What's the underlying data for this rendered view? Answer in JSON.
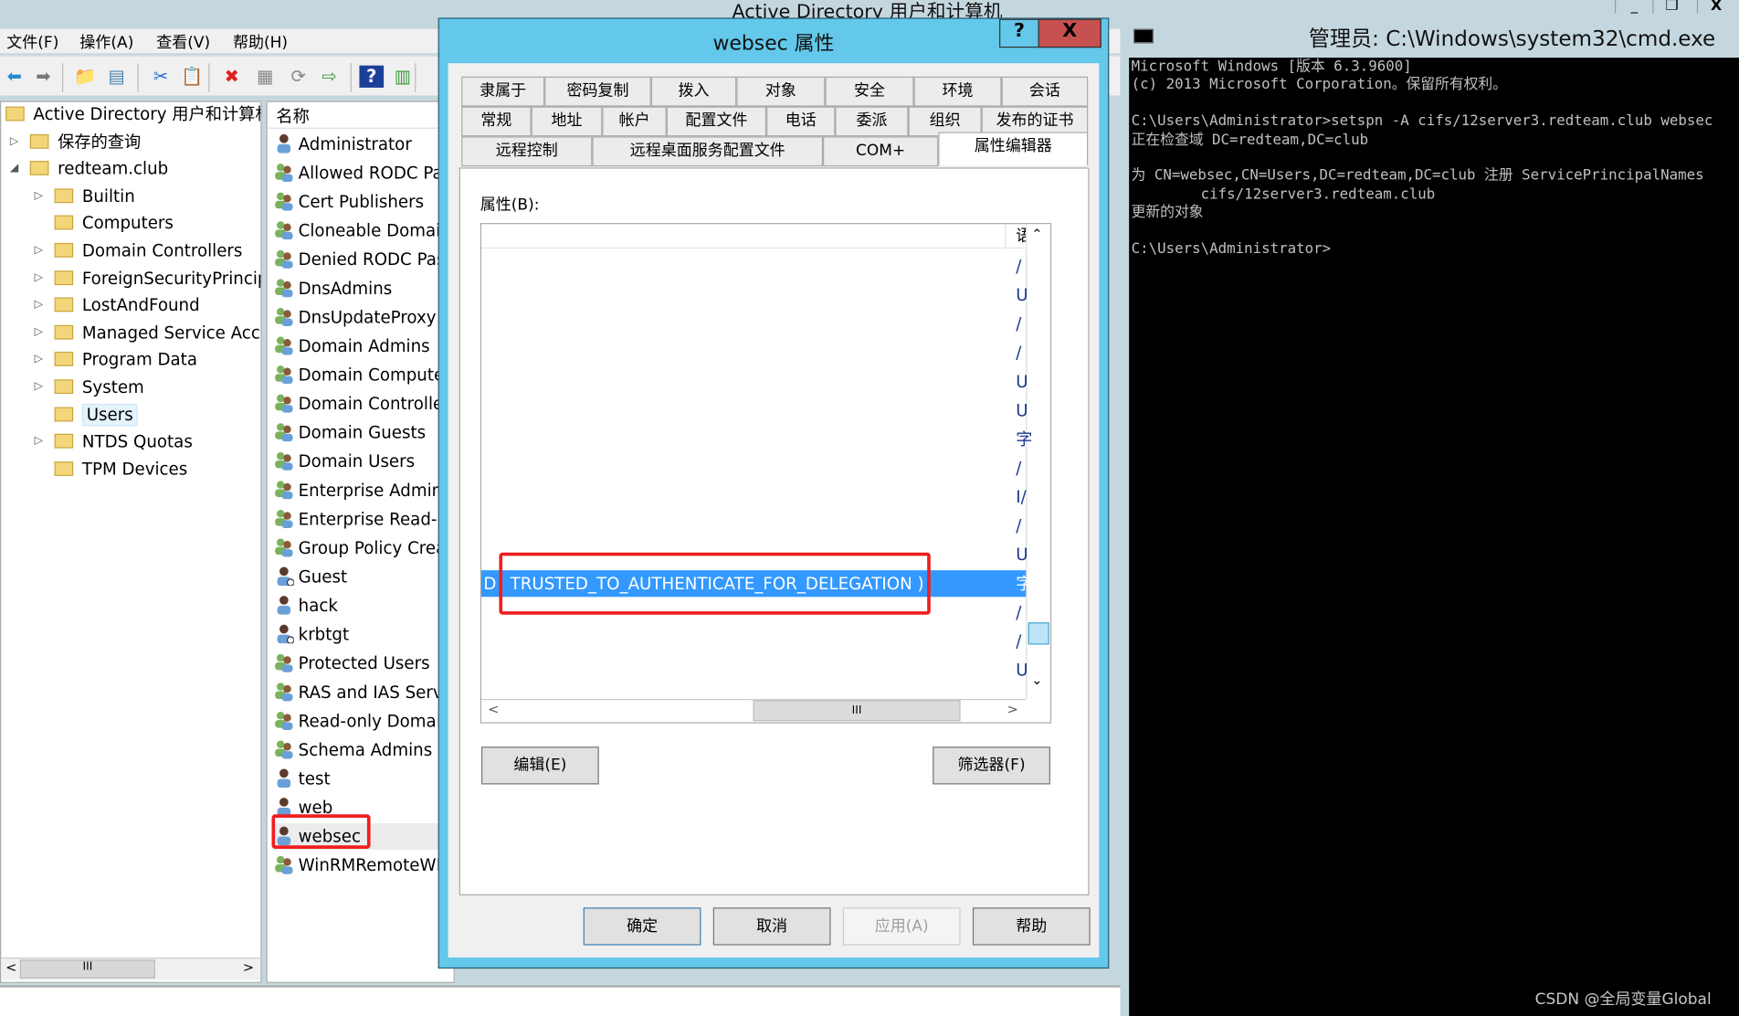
{
  "app": {
    "title": "Active Directory 用户和计算机"
  },
  "menu": [
    "文件(F)",
    "操作(A)",
    "查看(V)",
    "帮助(H)"
  ],
  "toolbar_icons": [
    "back-icon",
    "forward-icon",
    "up-folder-icon",
    "show-tree-icon",
    "cut-icon",
    "paste-icon",
    "delete-icon",
    "properties-icon",
    "refresh-icon",
    "export-icon",
    "help-icon",
    "console-icon"
  ],
  "tree": {
    "root": "Active Directory 用户和计算机",
    "items": [
      {
        "label": "保存的查询",
        "level": 1,
        "expander": "▷"
      },
      {
        "label": "redteam.club",
        "level": 1,
        "expander": "◢"
      },
      {
        "label": "Builtin",
        "level": 2,
        "expander": "▷"
      },
      {
        "label": "Computers",
        "level": 2,
        "expander": ""
      },
      {
        "label": "Domain Controllers",
        "level": 2,
        "expander": "▷"
      },
      {
        "label": "ForeignSecurityPrincipals",
        "level": 2,
        "expander": "▷"
      },
      {
        "label": "LostAndFound",
        "level": 2,
        "expander": "▷"
      },
      {
        "label": "Managed Service Accounts",
        "level": 2,
        "expander": "▷"
      },
      {
        "label": "Program Data",
        "level": 2,
        "expander": "▷"
      },
      {
        "label": "System",
        "level": 2,
        "expander": "▷"
      },
      {
        "label": "Users",
        "level": 2,
        "expander": "",
        "selected": true
      },
      {
        "label": "NTDS Quotas",
        "level": 2,
        "expander": "▷"
      },
      {
        "label": "TPM Devices",
        "level": 2,
        "expander": ""
      }
    ]
  },
  "list": {
    "header": "名称",
    "items": [
      {
        "name": "Administrator",
        "type": "user"
      },
      {
        "name": "Allowed RODC Password Replication Group",
        "type": "group"
      },
      {
        "name": "Cert Publishers",
        "type": "group"
      },
      {
        "name": "Cloneable Domain Controllers",
        "type": "group"
      },
      {
        "name": "Denied RODC Password Replication Group",
        "type": "group"
      },
      {
        "name": "DnsAdmins",
        "type": "group"
      },
      {
        "name": "DnsUpdateProxy",
        "type": "group"
      },
      {
        "name": "Domain Admins",
        "type": "group"
      },
      {
        "name": "Domain Computers",
        "type": "group"
      },
      {
        "name": "Domain Controllers",
        "type": "group"
      },
      {
        "name": "Domain Guests",
        "type": "group"
      },
      {
        "name": "Domain Users",
        "type": "group"
      },
      {
        "name": "Enterprise Admins",
        "type": "group"
      },
      {
        "name": "Enterprise Read-only Domain Controllers",
        "type": "group"
      },
      {
        "name": "Group Policy Creator Owners",
        "type": "group"
      },
      {
        "name": "Guest",
        "type": "user-disabled"
      },
      {
        "name": "hack",
        "type": "user"
      },
      {
        "name": "krbtgt",
        "type": "user-disabled"
      },
      {
        "name": "Protected Users",
        "type": "group"
      },
      {
        "name": "RAS and IAS Servers",
        "type": "group"
      },
      {
        "name": "Read-only Domain Controllers",
        "type": "group"
      },
      {
        "name": "Schema Admins",
        "type": "group"
      },
      {
        "name": "test",
        "type": "user"
      },
      {
        "name": "web",
        "type": "user"
      },
      {
        "name": "websec",
        "type": "user",
        "selected": true
      },
      {
        "name": "WinRMRemoteWMIUsers__",
        "type": "group"
      }
    ]
  },
  "dialog": {
    "title": "websec 属性",
    "help": "?",
    "close": "X",
    "tabs_row1": [
      "隶属于",
      "密码复制",
      "拨入",
      "对象",
      "安全",
      "环境",
      "会话"
    ],
    "tabs_row2": [
      "常规",
      "地址",
      "帐户",
      "配置文件",
      "电话",
      "委派",
      "组织",
      "发布的证书"
    ],
    "tabs_row3": [
      "远程控制",
      "远程桌面服务配置文件",
      "COM+",
      "属性编辑器"
    ],
    "active_tab": "属性编辑器",
    "attributes_label": "属性(B):",
    "col_edge_header": "语",
    "row_edges": [
      "/",
      "U",
      "/",
      "/",
      "U",
      "U",
      "字",
      "/",
      "I/",
      "/",
      "U",
      "字",
      "/",
      "/",
      "U"
    ],
    "selected_row_index": 11,
    "selected_value_prefix": "D",
    "selected_value": "TRUSTED_TO_AUTHENTICATE_FOR_DELEGATION )",
    "edit_button": "编辑(E)",
    "filter_button": "筛选器(F)",
    "ok": "确定",
    "cancel": "取消",
    "apply": "应用(A)",
    "help_button": "帮助"
  },
  "cmd": {
    "title": "管理员: C:\\Windows\\system32\\cmd.exe",
    "lines": [
      "Microsoft Windows [版本 6.3.9600]",
      "(c) 2013 Microsoft Corporation。保留所有权利。",
      "",
      "C:\\Users\\Administrator>setspn -A cifs/12server3.redteam.club websec",
      "正在检查域 DC=redteam,DC=club",
      "",
      "为 CN=websec,CN=Users,DC=redteam,DC=club 注册 ServicePrincipalNames",
      "        cifs/12server3.redteam.club",
      "更新的对象",
      "",
      "C:\\Users\\Administrator>"
    ]
  },
  "watermark": "CSDN @全局变量Global",
  "colors": {
    "dialog_frame": "#63c8ea",
    "close_red": "#c75050",
    "selection": "#3399ff",
    "highlight_box": "#f01e1e"
  }
}
